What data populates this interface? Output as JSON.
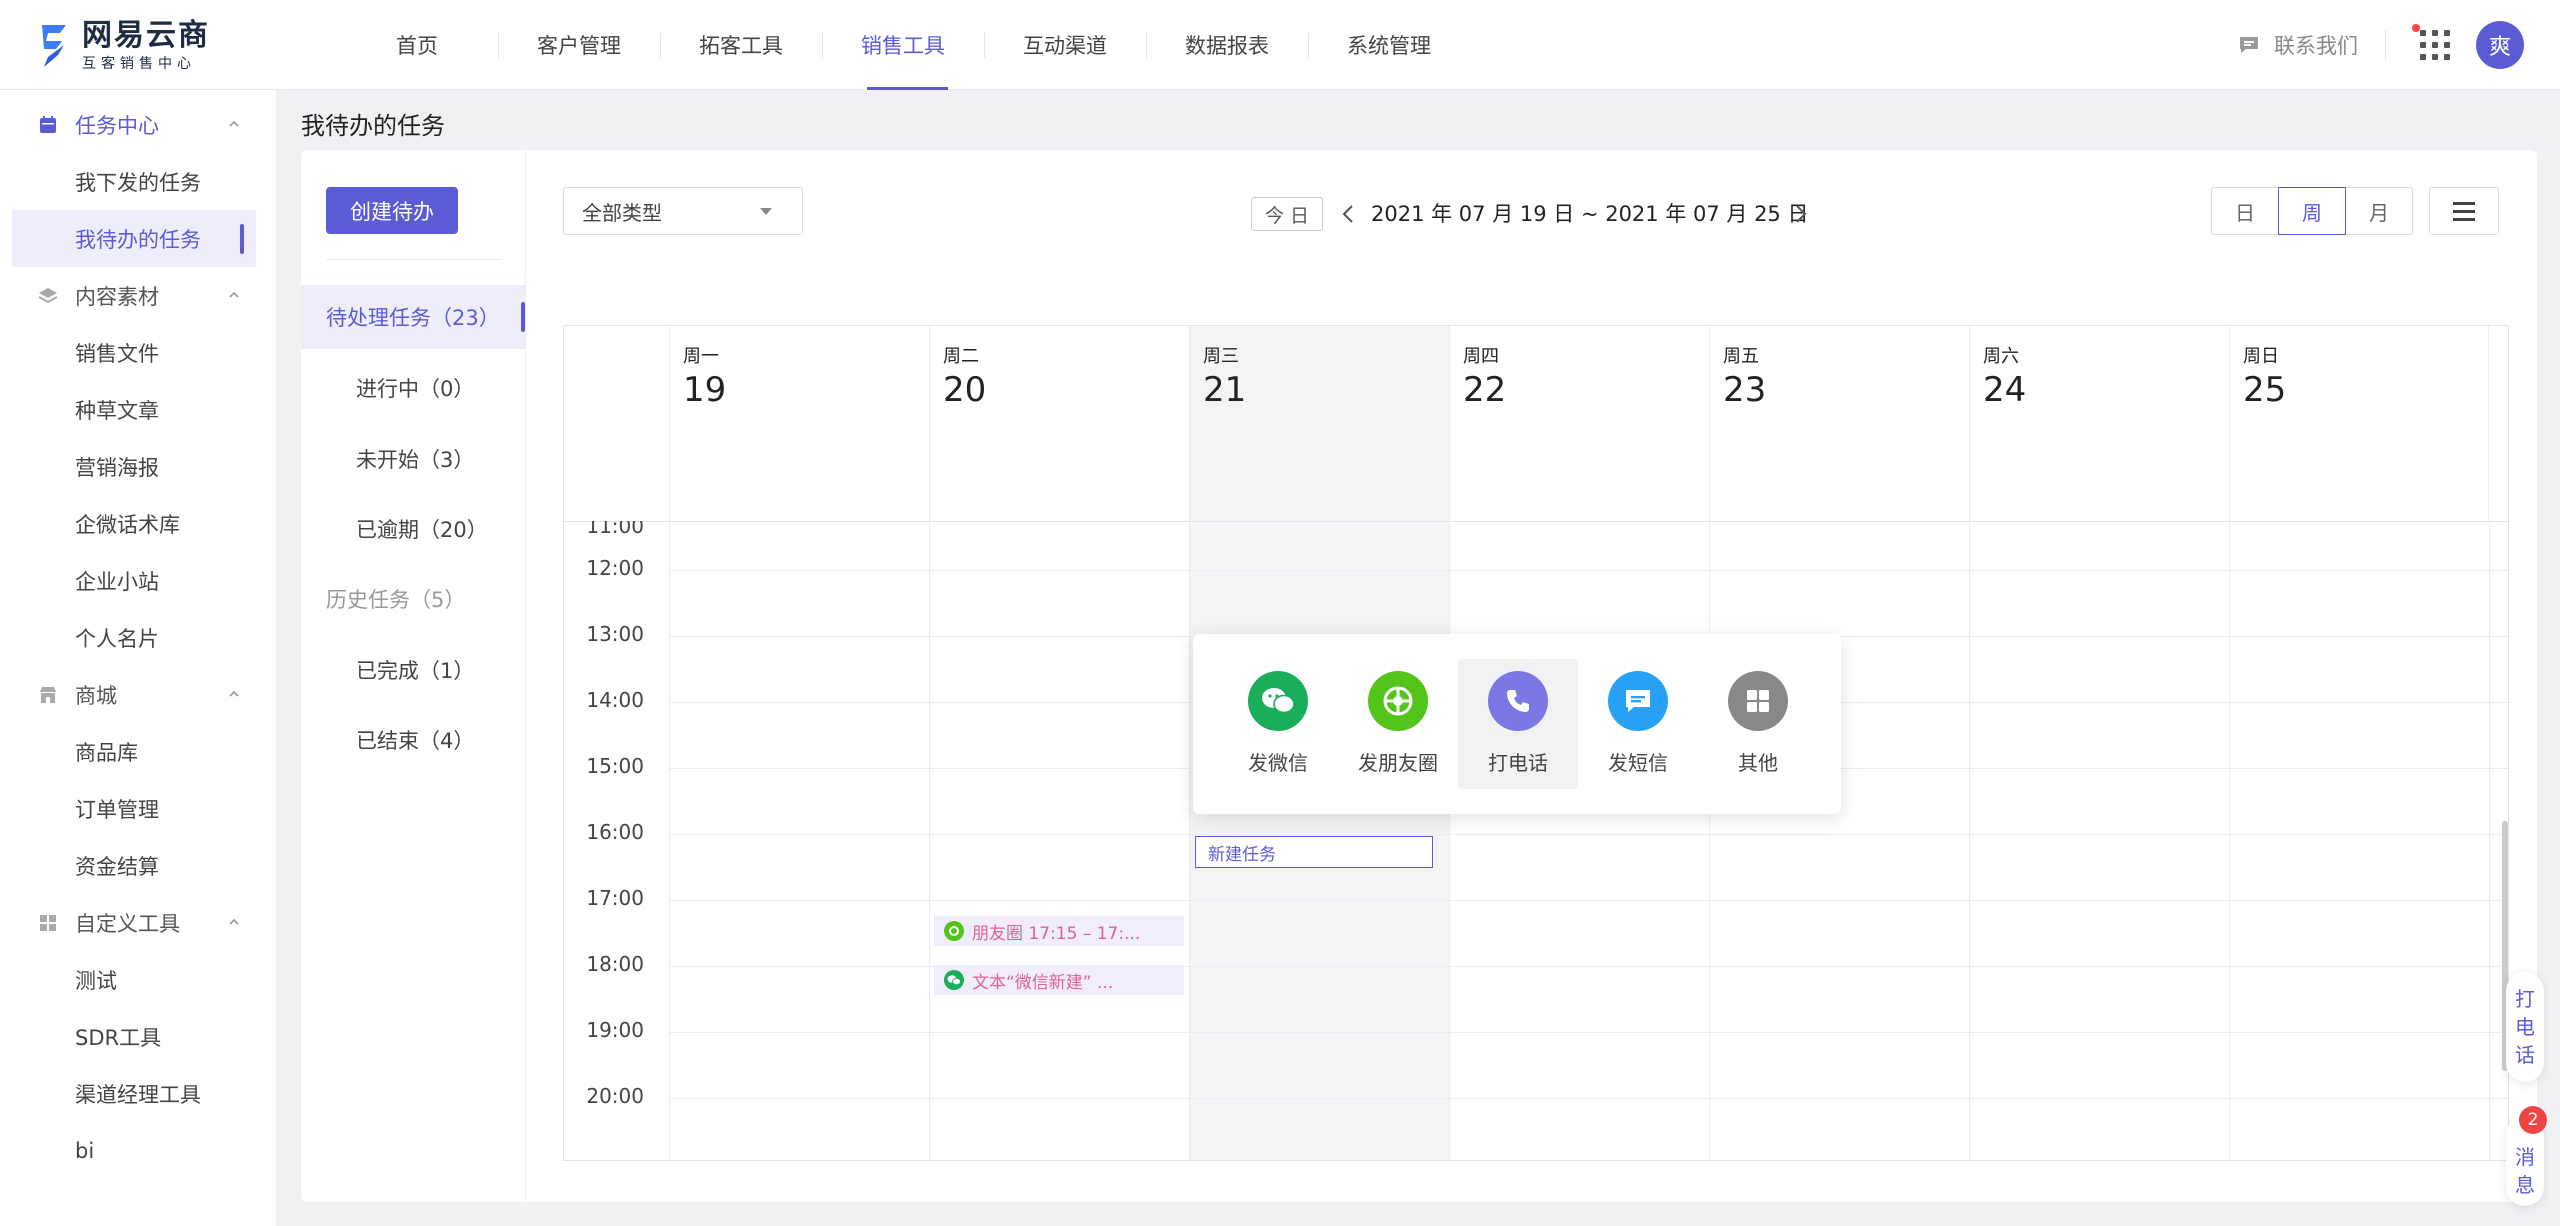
{
  "logo": {
    "title": "网易云商",
    "subtitle": "互客销售中心"
  },
  "nav": [
    "首页",
    "客户管理",
    "拓客工具",
    "销售工具",
    "互动渠道",
    "数据报表",
    "系统管理"
  ],
  "header": {
    "contact": "联系我们",
    "avatar": "爽"
  },
  "sidebar": {
    "groups": [
      {
        "label": "任务中心",
        "icon": "calendar-icon",
        "items": [
          "我下发的任务",
          "我待办的任务"
        ]
      },
      {
        "label": "内容素材",
        "icon": "layers-icon",
        "items": [
          "销售文件",
          "种草文章",
          "营销海报",
          "企微话术库",
          "企业小站",
          "个人名片"
        ]
      },
      {
        "label": "商城",
        "icon": "store-icon",
        "items": [
          "商品库",
          "订单管理",
          "资金结算"
        ]
      },
      {
        "label": "自定义工具",
        "icon": "apps-icon",
        "items": [
          "测试",
          "SDR工具",
          "渠道经理工具",
          "bi"
        ]
      }
    ]
  },
  "page": {
    "title": "我待办的任务"
  },
  "left_panel": {
    "create_button": "创建待办",
    "pending": "待处理任务（23）",
    "in_progress": "进行中（0）",
    "not_started": "未开始（3）",
    "overdue": "已逾期（20）",
    "history": "历史任务（5）",
    "completed": "已完成（1）",
    "ended": "已结束（4）"
  },
  "toolbar": {
    "type_select": "全部类型",
    "today": "今 日",
    "date_range": "2021 年 07 月 19 日 ~ 2021 年 07 月 25 日",
    "views": [
      "日",
      "周",
      "月"
    ],
    "active_view": "周"
  },
  "calendar": {
    "days": [
      {
        "weekday": "周一",
        "date": "19"
      },
      {
        "weekday": "周二",
        "date": "20"
      },
      {
        "weekday": "周三",
        "date": "21"
      },
      {
        "weekday": "周四",
        "date": "22"
      },
      {
        "weekday": "周五",
        "date": "23"
      },
      {
        "weekday": "周六",
        "date": "24"
      },
      {
        "weekday": "周日",
        "date": "25"
      }
    ],
    "partial_hour": "11:00",
    "hours": [
      "12:00",
      "13:00",
      "14:00",
      "15:00",
      "16:00",
      "17:00",
      "18:00",
      "19:00",
      "20:00"
    ],
    "events": [
      {
        "label": "朋友圈 17:15 – 17:...",
        "icon": "moments-icon",
        "color": "#52c41a"
      },
      {
        "label": "文本“微信新建” ...",
        "icon": "wechat-icon",
        "color": "#1aad5a"
      }
    ],
    "new_task": "新建任务"
  },
  "popup": {
    "items": [
      {
        "label": "发微信",
        "icon": "wechat-icon",
        "color": "#1aad5a"
      },
      {
        "label": "发朋友圈",
        "icon": "moments-icon",
        "color": "#52c41a"
      },
      {
        "label": "打电话",
        "icon": "phone-icon",
        "color": "#7b78e6"
      },
      {
        "label": "发短信",
        "icon": "message-icon",
        "color": "#29a1f7"
      },
      {
        "label": "其他",
        "icon": "grid-icon",
        "color": "#888888"
      }
    ]
  },
  "floating": {
    "call": [
      "打",
      "电",
      "话"
    ],
    "message": [
      "消",
      "息"
    ],
    "badge": "2"
  },
  "colors": {
    "accent": "#5b5bd6",
    "event_text": "#e0609a",
    "badge": "#f04545"
  }
}
